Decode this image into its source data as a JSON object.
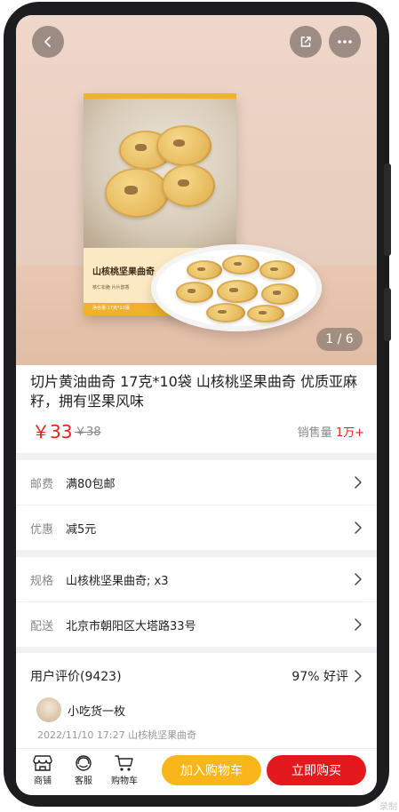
{
  "gallery": {
    "page_indicator": "1 / 6",
    "package_title": "山核桃坚果曲奇",
    "package_sub": "核仁松脆 片片醇香",
    "package_net": "净含量:17克*10袋"
  },
  "product": {
    "title": "切片黄油曲奇 17克*10袋 山核桃坚果曲奇 优质亚麻籽，拥有坚果风味",
    "price": "￥33",
    "old_price": "￥38",
    "sales_label": "销售量",
    "sales_value": "1万+"
  },
  "shipping": {
    "label": "邮费",
    "value": "满80包邮"
  },
  "discount": {
    "label": "优惠",
    "value": "减5元"
  },
  "spec": {
    "label": "规格",
    "value": "山核桃坚果曲奇; x3"
  },
  "delivery": {
    "label": "配送",
    "value": "北京市朝阳区大塔路33号"
  },
  "reviews": {
    "header": "用户评价(9423)",
    "positive_rate": "97% 好评",
    "user": "小吃货一枚",
    "meta": "2022/11/10 17:27 山核桃坚果曲奇"
  },
  "bottom_bar": {
    "shop": "商铺",
    "service": "客服",
    "cart": "购物车",
    "add_to_cart": "加入购物车",
    "buy_now": "立即购买"
  },
  "watermark": "录制",
  "colors": {
    "accent_red": "#e3231a",
    "cart_yellow": "#f8b61a",
    "buy_red": "#e4191e"
  }
}
